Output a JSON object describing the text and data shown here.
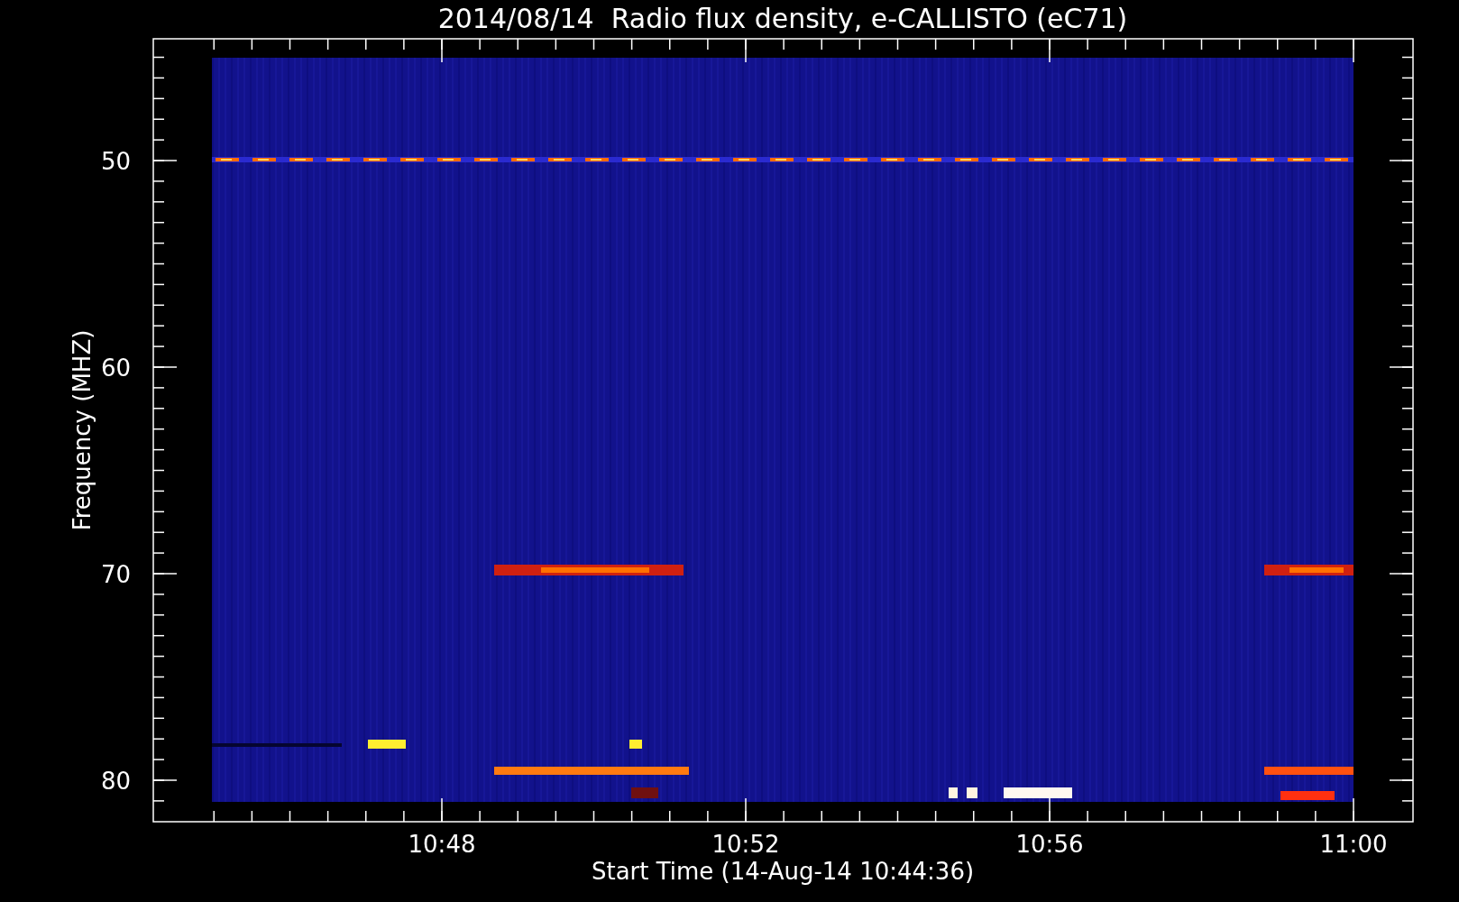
{
  "plot": {
    "title": "2014/08/14  Radio flux density, e-CALLISTO (eC71)",
    "ylabel": "Frequency (MHZ)",
    "xlabel": "Start Time (14-Aug-14 10:44:36)",
    "y_tick_labels": [
      "50",
      "60",
      "70",
      "80"
    ],
    "x_tick_labels": [
      "10:48",
      "10:52",
      "10:56",
      "11:00"
    ]
  }
}
